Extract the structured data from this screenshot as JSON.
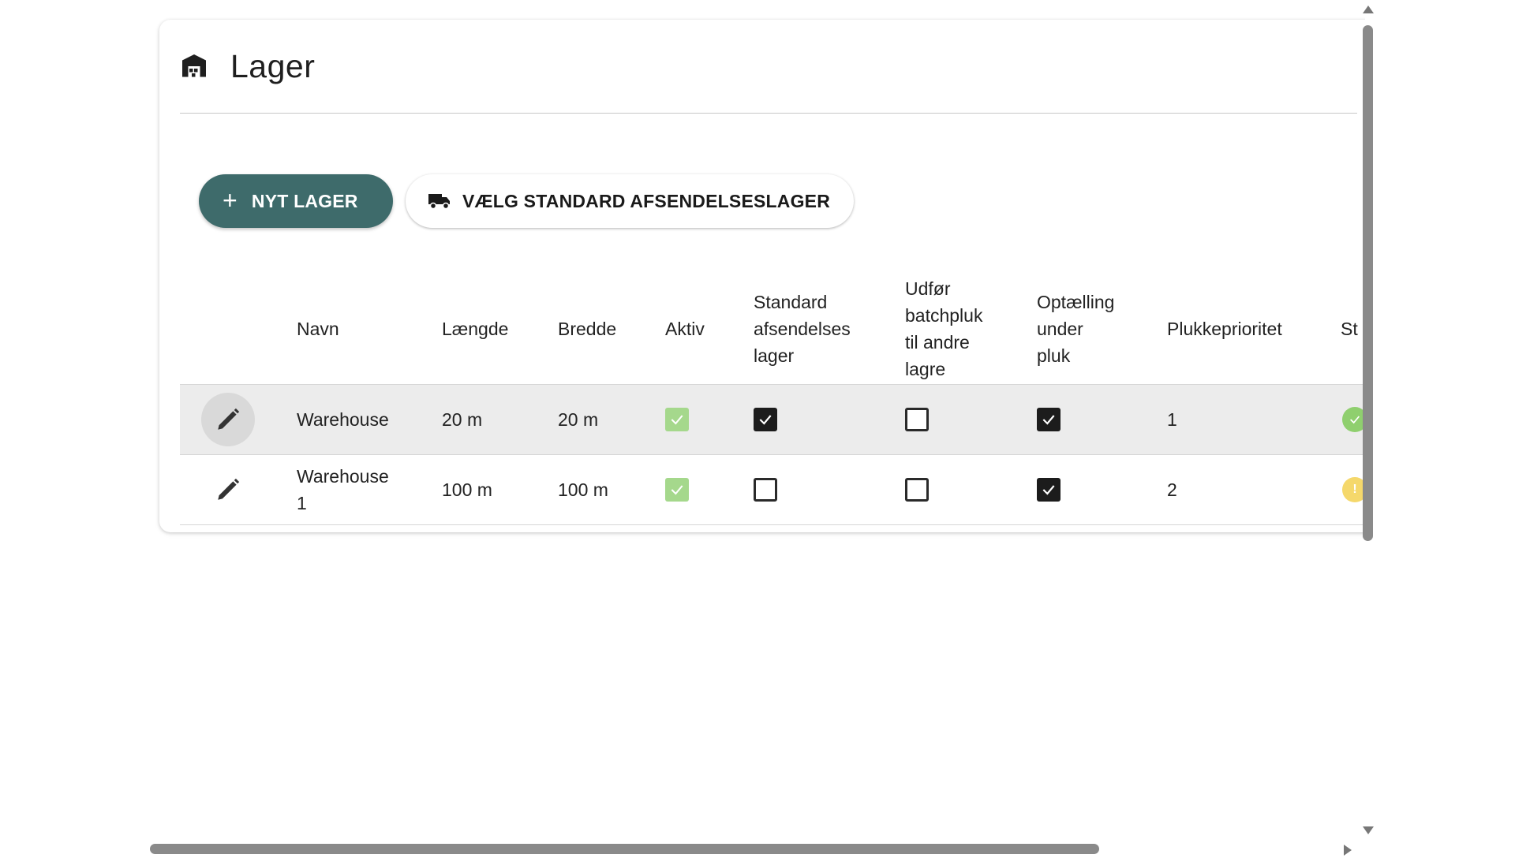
{
  "page": {
    "title": "Lager",
    "icon": "warehouse-icon"
  },
  "toolbar": {
    "new_label": "NYT LAGER",
    "new_icon": "plus-icon",
    "standard_label": "VÆLG STANDARD AFSENDELSESLAGER",
    "standard_icon": "truck-icon"
  },
  "table": {
    "headers": {
      "navn": "Navn",
      "laengde": "Længde",
      "bredde": "Bredde",
      "aktiv": "Aktiv",
      "standard_1": "Standard",
      "standard_2": "afsendelses",
      "standard_3": "lager",
      "batch_1": "Udfør",
      "batch_2": "batchpluk",
      "batch_3": "til andre",
      "batch_4": "lagre",
      "optaelling_1": "Optælling",
      "optaelling_2": "under",
      "optaelling_3": "pluk",
      "plukkeprioritet": "Plukkeprioritet",
      "status_partial": "St"
    },
    "rows": [
      {
        "navn_1": "Warehouse",
        "navn_2": "",
        "laengde": "20 m",
        "bredde": "20 m",
        "aktiv": true,
        "standard": true,
        "batch": false,
        "optaelling": true,
        "plukkeprioritet": "1",
        "status_color": "#8fcf6e"
      },
      {
        "navn_1": "Warehouse",
        "navn_2": "1",
        "laengde": "100 m",
        "bredde": "100 m",
        "aktiv": true,
        "standard": false,
        "batch": false,
        "optaelling": true,
        "plukkeprioritet": "2",
        "status_color": "#f5d86b"
      }
    ]
  },
  "colors": {
    "primary": "#3e6b6b",
    "active_green": "#a5d88c",
    "checkbox_dark": "#1c1c1c"
  }
}
